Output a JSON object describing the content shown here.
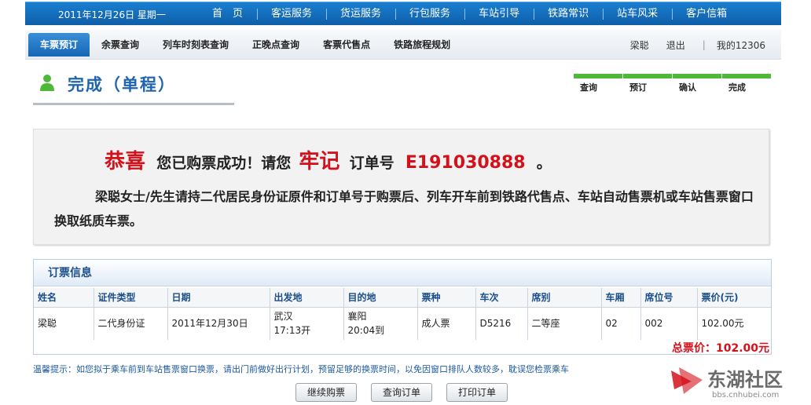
{
  "header": {
    "date": "2011年12月26日 星期一",
    "nav": [
      "首　页",
      "客运服务",
      "货运服务",
      "行包服务",
      "车站引导",
      "铁路常识",
      "站车风采",
      "客户信箱"
    ]
  },
  "subnav": {
    "items": [
      "车票预订",
      "余票查询",
      "列车时刻表查询",
      "正晚点查询",
      "客票代售点",
      "铁路旅程规划"
    ],
    "user": "梁聪",
    "logout": "退出",
    "separator": "|",
    "my12306": "我的12306"
  },
  "page": {
    "title": "完成（单程）",
    "steps": [
      "查询",
      "预订",
      "确认",
      "完成"
    ],
    "step_color": "#4fb83a"
  },
  "success": {
    "congrats": "恭喜",
    "text1": "您已购票成功！请您",
    "remember": "牢记",
    "text2": "订单号",
    "order_no": "E191030888",
    "period": "。",
    "note": "梁聪女士/先生请持二代居民身份证原件和订单号于购票后、列车开车前到铁路代售点、车站自动售票机或车站售票窗口换取纸质车票。"
  },
  "booking": {
    "title": "订票信息",
    "headers": [
      "姓名",
      "证件类型",
      "日期",
      "出发地",
      "目的地",
      "票种",
      "车次",
      "席别",
      "车厢",
      "席位号",
      "票价(元)"
    ],
    "row": {
      "name": "梁聪",
      "id_type": "二代身份证",
      "date": "2011年12月30日",
      "from_station": "武汉",
      "from_time": "17:13开",
      "to_station": "襄阳",
      "to_time": "20:04到",
      "ticket_type": "成人票",
      "train": "D5216",
      "seat_class": "二等座",
      "car": "02",
      "seat_no": "002",
      "price": "102.00元"
    },
    "total": "总票价：102.00元"
  },
  "tip": "温馨提示：如您拟于乘车前到车站售票窗口换票，请出门前做好出行计划，预留足够的换票时间，以免因窗口排队人数较多，耽误您检票乘车",
  "buttons": [
    "继续购票",
    "查询订单",
    "打印订单"
  ],
  "watermark": {
    "text": "东湖社区",
    "url": "bbs.cnhubei.com"
  },
  "colors": {
    "accent_blue": "#1566b5",
    "alert_red": "#d4111b"
  }
}
